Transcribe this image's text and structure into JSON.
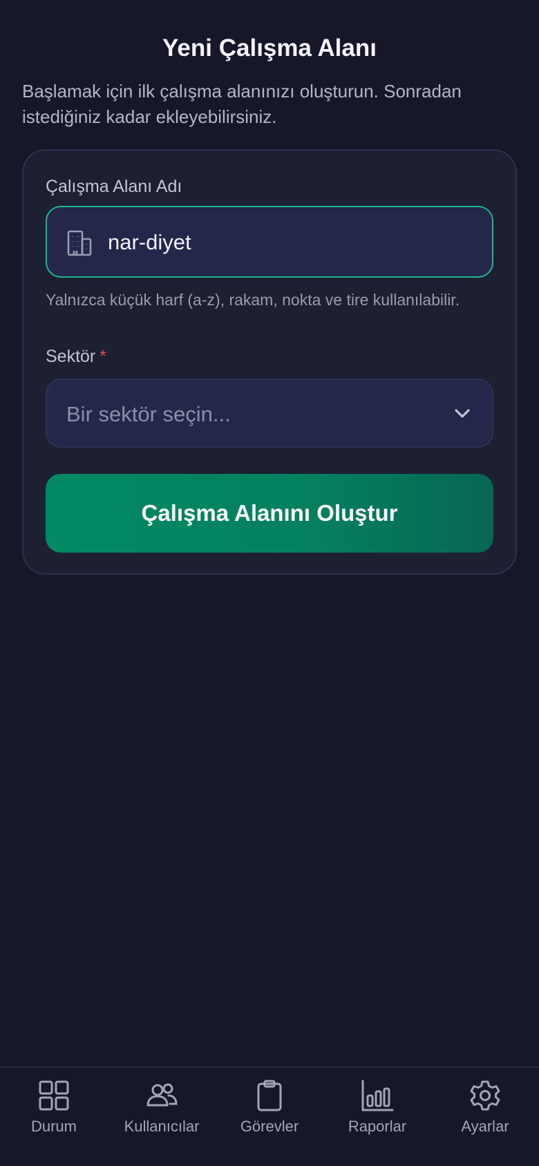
{
  "header": {
    "title": "Yeni Çalışma Alanı",
    "subtitle": "Başlamak için ilk çalışma alanınızı oluşturun. Sonradan istediğiniz kadar ekleyebilirsiniz."
  },
  "form": {
    "workspace_name": {
      "label": "Çalışma Alanı Adı",
      "value": "nar-diyet",
      "hint": "Yalnızca küçük harf (a-z), rakam, nokta ve tire kullanılabilir.",
      "icon": "building-icon"
    },
    "sector": {
      "label": "Sektör",
      "required_mark": "*",
      "placeholder": "Bir sektör seçin...",
      "icon": "chevron-down-icon"
    },
    "submit_label": "Çalışma Alanını Oluştur"
  },
  "nav": {
    "items": [
      {
        "label": "Durum",
        "icon": "dashboard-grid-icon"
      },
      {
        "label": "Kullanıcılar",
        "icon": "users-icon"
      },
      {
        "label": "Görevler",
        "icon": "clipboard-icon"
      },
      {
        "label": "Raporlar",
        "icon": "bar-chart-icon"
      },
      {
        "label": "Ayarlar",
        "icon": "gear-icon"
      }
    ]
  },
  "colors": {
    "background": "#161829",
    "card": "#1d1f33",
    "accent": "#22b58f",
    "button": "#008a63",
    "required": "#e5484d"
  }
}
